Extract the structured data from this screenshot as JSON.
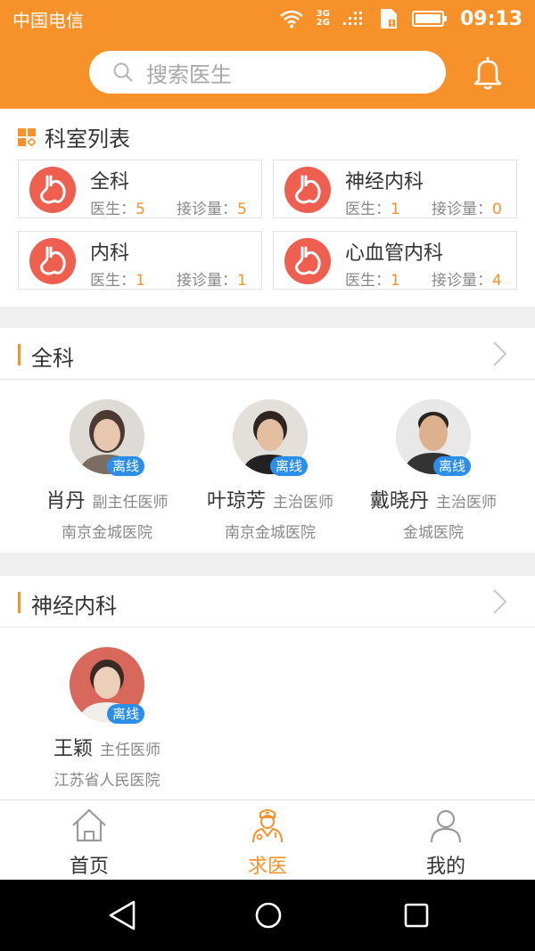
{
  "status_bar": {
    "carrier": "中国电信",
    "network": "3G\n2G",
    "time": "09:13"
  },
  "search": {
    "placeholder": "搜索医生"
  },
  "dept_section": {
    "title": "科室列表",
    "departments": [
      {
        "name": "全科",
        "doctor_label": "医生：",
        "doctors": "5",
        "visits_label": "接诊量：",
        "visits": "5"
      },
      {
        "name": "神经内科",
        "doctor_label": "医生：",
        "doctors": "1",
        "visits_label": "接诊量：",
        "visits": "0"
      },
      {
        "name": "内科",
        "doctor_label": "医生：",
        "doctors": "1",
        "visits_label": "接诊量：",
        "visits": "1"
      },
      {
        "name": "心血管内科",
        "doctor_label": "医生：",
        "doctors": "1",
        "visits_label": "接诊量：",
        "visits": "4"
      }
    ]
  },
  "groups": [
    {
      "title": "全科",
      "doctors": [
        {
          "name": "肖丹",
          "title": "副主任医师",
          "hospital": "南京金城医院",
          "status": "离线"
        },
        {
          "name": "叶琼芳",
          "title": "主治医师",
          "hospital": "南京金城医院",
          "status": "离线"
        },
        {
          "name": "戴晓丹",
          "title": "主治医师",
          "hospital": "金城医院",
          "status": "离线"
        }
      ]
    },
    {
      "title": "神经内科",
      "doctors": [
        {
          "name": "王颖",
          "title": "主任医师",
          "hospital": "江苏省人民医院",
          "status": "离线"
        }
      ]
    }
  ],
  "tabbar": {
    "items": [
      {
        "label": "首页",
        "icon": "home-icon"
      },
      {
        "label": "求医",
        "icon": "doctor-icon",
        "active": true
      },
      {
        "label": "我的",
        "icon": "profile-icon"
      }
    ]
  },
  "colors": {
    "accent": "#f7922a",
    "dept_logo": "#ee5f4f",
    "offline_badge": "#2b8ee8"
  }
}
